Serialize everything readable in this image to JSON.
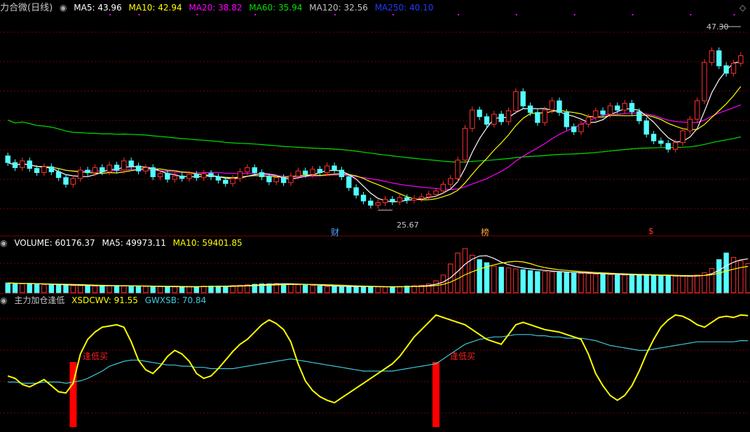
{
  "colors": {
    "up": "#ff3232",
    "down": "#54ffff",
    "ma5": "#ffffff",
    "ma10": "#ffff00",
    "ma20": "#ff00ff",
    "ma60": "#00e000",
    "ma120": "#c0c0c0",
    "ma250": "#1e3cff",
    "grid": "#7a0000",
    "xsdcwv": "#ffff00",
    "gwxsb": "#3fc8d8",
    "signal": "#ff0000"
  },
  "header_price": {
    "title": "力合微(日线)",
    "ma5": "MA5: 43.96",
    "ma10": "MA10: 42.94",
    "ma20": "MA20: 38.82",
    "ma60": "MA60: 35.94",
    "ma120": "MA120: 32.56",
    "ma250": "MA250: 40.10"
  },
  "header_volume": {
    "vol": "VOLUME: 60176.37",
    "ma5": "MA5: 49973.11",
    "ma10": "MA10: 59401.85"
  },
  "header_indicator": {
    "name": "主力加仓逢低",
    "xsdcwv": "XSDCWV: 91.55",
    "gwxsb": "GWXSB: 70.84"
  },
  "annotations": {
    "high_label": "47.30",
    "low_label": "25.67",
    "event1": "财",
    "event2": "榜",
    "event3": "$",
    "signal1": "逢低买",
    "signal2": "逢低买"
  },
  "chart_data": [
    {
      "type": "candlestick",
      "title": "力合微(日线)",
      "ylim": [
        23,
        49
      ],
      "high_marker": 47.3,
      "low_marker": 25.67,
      "candles": [
        {
          "o": 32.0,
          "c": 31.2
        },
        {
          "o": 31.2,
          "c": 30.6
        },
        {
          "o": 30.6,
          "c": 31.4
        },
        {
          "o": 31.4,
          "c": 30.5
        },
        {
          "o": 30.5,
          "c": 30.0
        },
        {
          "o": 30.0,
          "c": 30.7
        },
        {
          "o": 30.7,
          "c": 30.1
        },
        {
          "o": 30.1,
          "c": 29.4
        },
        {
          "o": 29.4,
          "c": 28.6
        },
        {
          "o": 28.6,
          "c": 29.3
        },
        {
          "o": 29.3,
          "c": 30.3
        },
        {
          "o": 30.3,
          "c": 30.0
        },
        {
          "o": 30.0,
          "c": 30.6
        },
        {
          "o": 30.6,
          "c": 30.1
        },
        {
          "o": 30.1,
          "c": 30.9
        },
        {
          "o": 30.9,
          "c": 30.3
        },
        {
          "o": 30.3,
          "c": 31.4
        },
        {
          "o": 31.4,
          "c": 30.8
        },
        {
          "o": 30.8,
          "c": 30.2
        },
        {
          "o": 30.2,
          "c": 30.6
        },
        {
          "o": 30.6,
          "c": 29.5
        },
        {
          "o": 29.5,
          "c": 29.9
        },
        {
          "o": 29.9,
          "c": 29.2
        },
        {
          "o": 29.2,
          "c": 29.6
        },
        {
          "o": 29.6,
          "c": 29.3
        },
        {
          "o": 29.3,
          "c": 29.8
        },
        {
          "o": 29.8,
          "c": 29.4
        },
        {
          "o": 29.4,
          "c": 29.9
        },
        {
          "o": 29.9,
          "c": 29.5
        },
        {
          "o": 29.5,
          "c": 29.1
        },
        {
          "o": 29.1,
          "c": 28.7
        },
        {
          "o": 28.7,
          "c": 29.3
        },
        {
          "o": 29.3,
          "c": 30.1
        },
        {
          "o": 30.1,
          "c": 30.6
        },
        {
          "o": 30.6,
          "c": 30.0
        },
        {
          "o": 30.0,
          "c": 29.5
        },
        {
          "o": 29.5,
          "c": 28.9
        },
        {
          "o": 28.9,
          "c": 29.4
        },
        {
          "o": 29.4,
          "c": 28.8
        },
        {
          "o": 28.8,
          "c": 29.6
        },
        {
          "o": 29.6,
          "c": 30.2
        },
        {
          "o": 30.2,
          "c": 29.8
        },
        {
          "o": 29.8,
          "c": 30.4
        },
        {
          "o": 30.4,
          "c": 30.0
        },
        {
          "o": 30.0,
          "c": 30.8
        },
        {
          "o": 30.8,
          "c": 30.3
        },
        {
          "o": 30.3,
          "c": 29.5
        },
        {
          "o": 29.5,
          "c": 28.2
        },
        {
          "o": 28.2,
          "c": 27.3
        },
        {
          "o": 27.3,
          "c": 26.6
        },
        {
          "o": 26.6,
          "c": 26.1
        },
        {
          "o": 26.1,
          "c": 26.4
        },
        {
          "o": 26.4,
          "c": 26.8
        },
        {
          "o": 26.8,
          "c": 26.5
        },
        {
          "o": 26.5,
          "c": 27.0
        },
        {
          "o": 27.0,
          "c": 26.7
        },
        {
          "o": 26.7,
          "c": 26.9
        },
        {
          "o": 26.9,
          "c": 27.1
        },
        {
          "o": 27.1,
          "c": 27.4
        },
        {
          "o": 27.4,
          "c": 27.8
        },
        {
          "o": 27.8,
          "c": 28.6
        },
        {
          "o": 28.6,
          "c": 29.3
        },
        {
          "o": 29.3,
          "c": 31.5
        },
        {
          "o": 31.5,
          "c": 35.3
        },
        {
          "o": 35.3,
          "c": 37.5
        },
        {
          "o": 37.5,
          "c": 36.7
        },
        {
          "o": 36.7,
          "c": 35.8
        },
        {
          "o": 35.8,
          "c": 37.0
        },
        {
          "o": 37.0,
          "c": 36.1
        },
        {
          "o": 36.1,
          "c": 37.4
        },
        {
          "o": 37.4,
          "c": 39.7
        },
        {
          "o": 39.7,
          "c": 38.0
        },
        {
          "o": 38.0,
          "c": 37.2
        },
        {
          "o": 37.2,
          "c": 36.0
        },
        {
          "o": 36.0,
          "c": 37.5
        },
        {
          "o": 37.5,
          "c": 38.6
        },
        {
          "o": 38.6,
          "c": 37.2
        },
        {
          "o": 37.2,
          "c": 35.5
        },
        {
          "o": 35.5,
          "c": 34.9
        },
        {
          "o": 34.9,
          "c": 35.8
        },
        {
          "o": 35.8,
          "c": 36.6
        },
        {
          "o": 36.6,
          "c": 37.4
        },
        {
          "o": 37.4,
          "c": 37.0
        },
        {
          "o": 37.0,
          "c": 38.0
        },
        {
          "o": 38.0,
          "c": 37.5
        },
        {
          "o": 37.5,
          "c": 38.3
        },
        {
          "o": 38.3,
          "c": 37.3
        },
        {
          "o": 37.3,
          "c": 36.2
        },
        {
          "o": 36.2,
          "c": 34.6
        },
        {
          "o": 34.6,
          "c": 33.8
        },
        {
          "o": 33.8,
          "c": 33.5
        },
        {
          "o": 33.5,
          "c": 32.8
        },
        {
          "o": 32.8,
          "c": 33.6
        },
        {
          "o": 33.6,
          "c": 35.0
        },
        {
          "o": 35.0,
          "c": 36.4
        },
        {
          "o": 36.4,
          "c": 38.6
        },
        {
          "o": 38.6,
          "c": 43.2
        },
        {
          "o": 43.2,
          "c": 44.6
        },
        {
          "o": 44.6,
          "c": 42.8
        },
        {
          "o": 42.8,
          "c": 41.9
        },
        {
          "o": 41.9,
          "c": 43.1
        },
        {
          "o": 43.1,
          "c": 44.0
        }
      ]
    },
    {
      "type": "bar",
      "title": "VOLUME",
      "values": [
        22,
        21,
        20,
        20,
        19,
        18,
        18,
        17,
        17,
        16,
        16,
        16,
        15,
        15,
        16,
        16,
        15,
        15,
        14,
        14,
        14,
        14,
        13,
        13,
        13,
        14,
        14,
        15,
        15,
        15,
        15,
        16,
        17,
        18,
        19,
        20,
        20,
        21,
        20,
        19,
        18,
        17,
        16,
        15,
        14,
        14,
        14,
        14,
        14,
        14,
        13,
        13,
        13,
        13,
        14,
        15,
        16,
        17,
        20,
        27,
        40,
        65,
        90,
        100,
        85,
        75,
        68,
        60,
        58,
        56,
        54,
        52,
        50,
        48,
        48,
        47,
        46,
        45,
        44,
        44,
        43,
        42,
        42,
        41,
        40,
        40,
        40,
        40,
        40,
        39,
        38,
        38,
        37,
        37,
        37,
        40,
        45,
        55,
        75,
        90,
        80,
        72,
        66
      ]
    },
    {
      "type": "line",
      "title": "主力加仓逢低",
      "series": [
        {
          "name": "XSDCWV",
          "values": [
            42,
            40,
            35,
            33,
            36,
            39,
            34,
            29,
            28,
            36,
            60,
            72,
            78,
            82,
            83,
            84,
            82,
            70,
            55,
            47,
            44,
            50,
            58,
            63,
            60,
            54,
            44,
            40,
            42,
            48,
            55,
            62,
            68,
            72,
            78,
            84,
            88,
            85,
            80,
            70,
            52,
            38,
            30,
            25,
            22,
            20,
            24,
            28,
            32,
            36,
            40,
            44,
            48,
            52,
            58,
            66,
            74,
            80,
            86,
            92,
            90,
            88,
            86,
            84,
            80,
            76,
            72,
            70,
            68,
            76,
            84,
            86,
            84,
            82,
            80,
            79,
            78,
            76,
            74,
            72,
            60,
            44,
            34,
            26,
            22,
            26,
            34,
            46,
            60,
            72,
            82,
            88,
            92,
            91,
            88,
            84,
            82,
            86,
            90,
            91,
            90,
            92,
            91.55
          ]
        },
        {
          "name": "GWXSB",
          "values": [
            37,
            37,
            36,
            36,
            36,
            37,
            37,
            37,
            36,
            37,
            38,
            40,
            43,
            46,
            50,
            52,
            54,
            55,
            55,
            54,
            53,
            52,
            51,
            51,
            50,
            50,
            49,
            49,
            48,
            48,
            48,
            48,
            49,
            50,
            51,
            52,
            53,
            54,
            55,
            56,
            55,
            54,
            53,
            52,
            51,
            50,
            49,
            48,
            47,
            46,
            46,
            46,
            46,
            46,
            47,
            48,
            49,
            50,
            51,
            52,
            56,
            60,
            64,
            68,
            70,
            72,
            73,
            74,
            74,
            75,
            76,
            76,
            76,
            75,
            75,
            74,
            74,
            73,
            73,
            73,
            72,
            71,
            69,
            67,
            66,
            65,
            64,
            63,
            63,
            64,
            65,
            66,
            67,
            68,
            69,
            70,
            70,
            70,
            70,
            70,
            70,
            71,
            70.84
          ]
        }
      ],
      "signals": [
        {
          "label": "逢低买"
        },
        {
          "label": "逢低买"
        }
      ]
    }
  ]
}
